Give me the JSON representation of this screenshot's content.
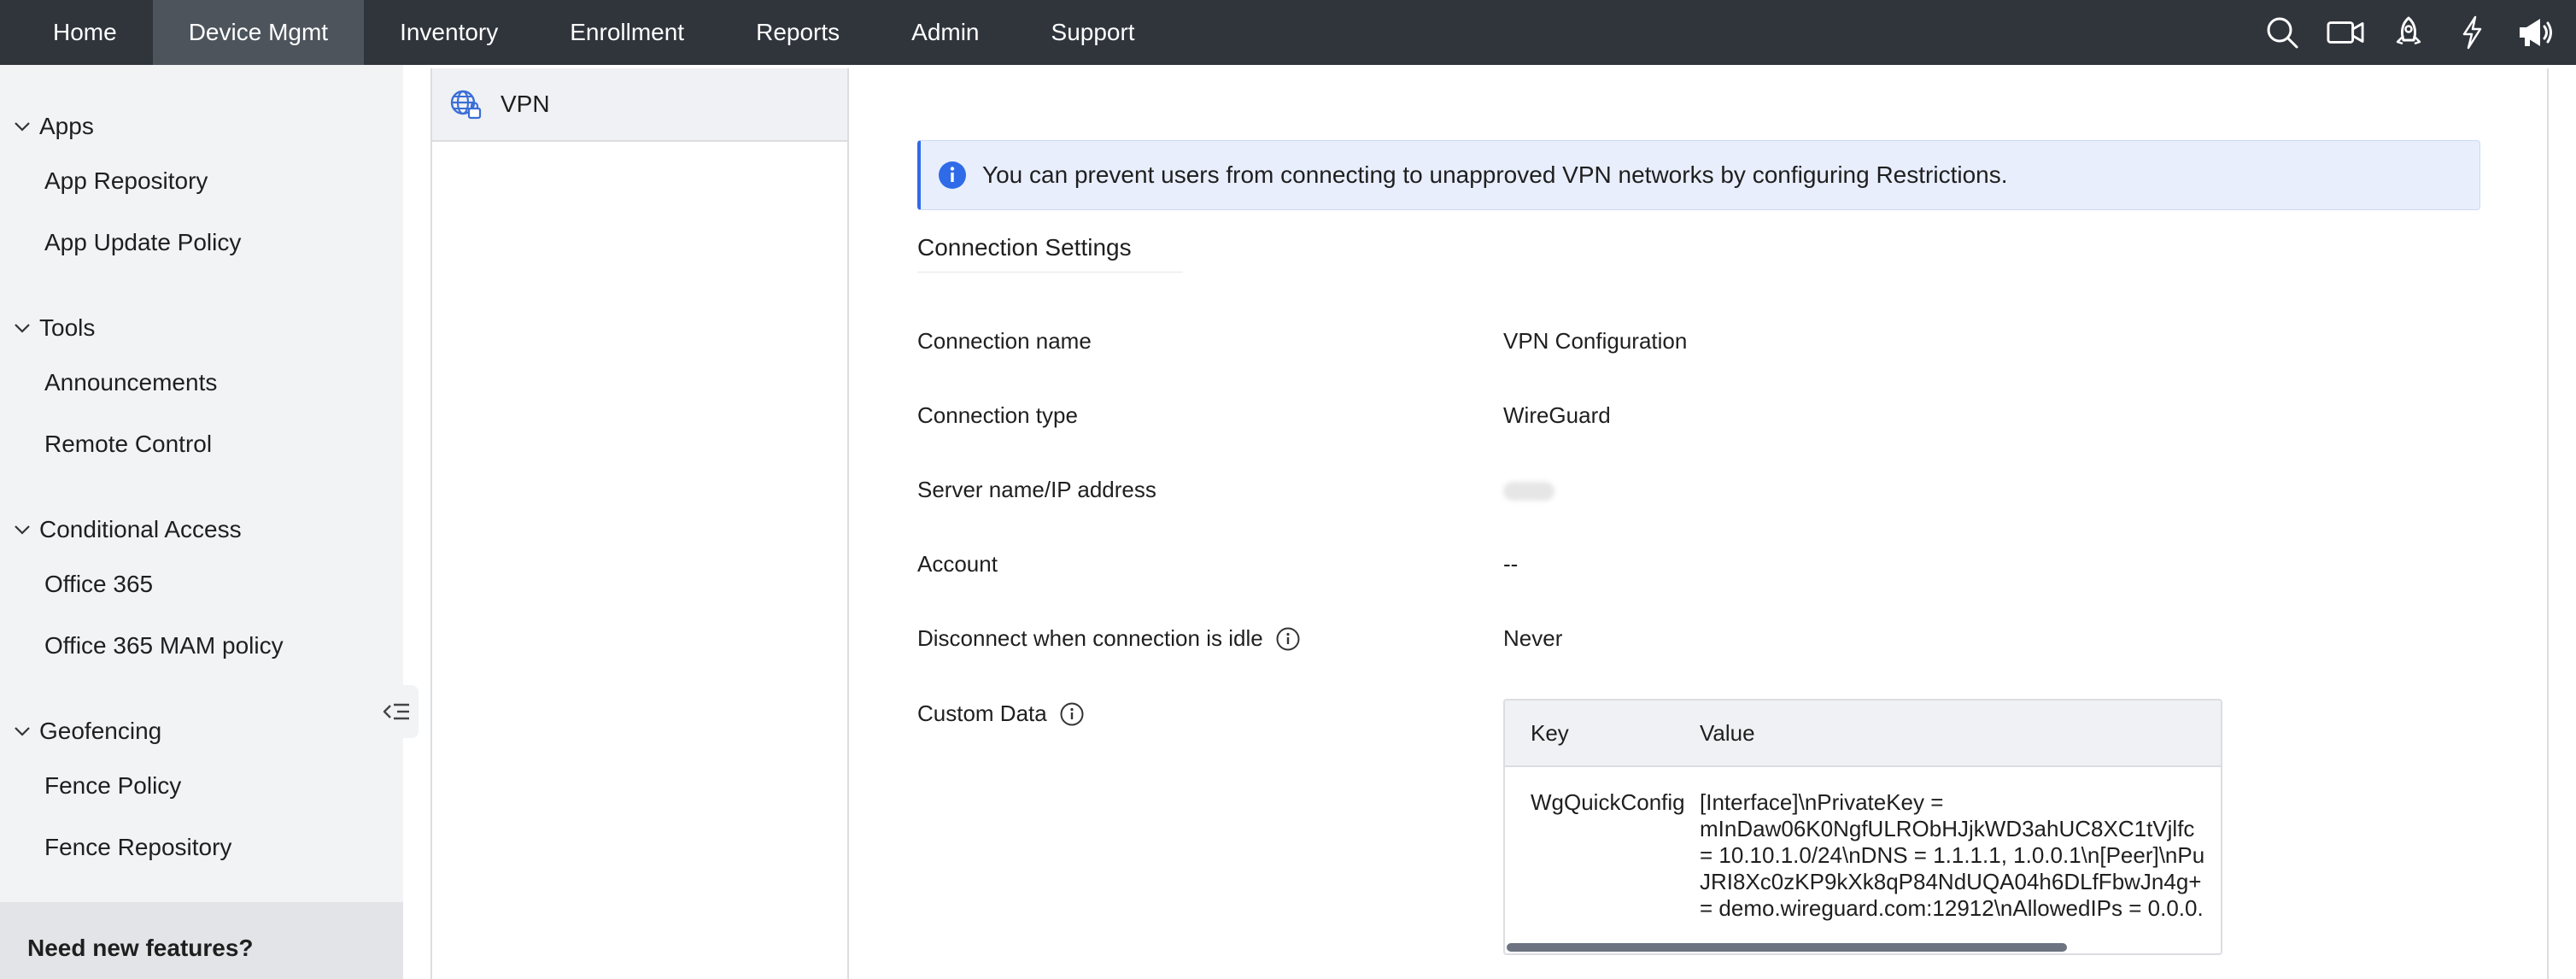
{
  "topnav": {
    "items": [
      "Home",
      "Device Mgmt",
      "Inventory",
      "Enrollment",
      "Reports",
      "Admin",
      "Support"
    ],
    "active": "Device Mgmt",
    "icons": [
      "search-icon",
      "video-icon",
      "rocket-icon",
      "lightning-icon",
      "megaphone-icon"
    ]
  },
  "sidebar": {
    "groups": [
      {
        "title": "Apps",
        "items": [
          "App Repository",
          "App Update Policy"
        ]
      },
      {
        "title": "Tools",
        "items": [
          "Announcements",
          "Remote Control"
        ]
      },
      {
        "title": "Conditional Access",
        "items": [
          "Office 365",
          "Office 365 MAM policy"
        ]
      },
      {
        "title": "Geofencing",
        "items": [
          "Fence Policy",
          "Fence Repository"
        ]
      }
    ],
    "feature_prompt": "Need new features?"
  },
  "midpanel": {
    "item_label": "VPN"
  },
  "content": {
    "info_banner": "You can prevent users from connecting to unapproved VPN networks by configuring Restrictions.",
    "section_title": "Connection Settings",
    "rows": {
      "connection_name": {
        "label": "Connection name",
        "value": "VPN Configuration"
      },
      "connection_type": {
        "label": "Connection type",
        "value": "WireGuard"
      },
      "server": {
        "label": "Server name/IP address",
        "value": ""
      },
      "account": {
        "label": "Account",
        "value": "--"
      },
      "idle": {
        "label": "Disconnect when connection is idle",
        "value": "Never"
      },
      "custom_data": {
        "label": "Custom Data"
      }
    },
    "custom_data_table": {
      "headers": {
        "key": "Key",
        "value": "Value"
      },
      "row": {
        "key": "WgQuickConfig",
        "value": "[Interface]\\nPrivateKey =\nmInDaw06K0NgfULRObHJjkWD3ahUC8XC1tVjlfc\n= 10.10.1.0/24\\nDNS = 1.1.1.1, 1.0.0.1\\n[Peer]\\nPu\nJRI8Xc0zKP9kXk8qP84NdUQA04h6DLfFbwJn4g+\n= demo.wireguard.com:12912\\nAllowedIPs = 0.0.0."
      }
    }
  },
  "colors": {
    "topbar": "#2f353b",
    "topbar_active": "#4d545c",
    "accent": "#2f6be8",
    "sidebar_bg": "#f2f3f5"
  }
}
